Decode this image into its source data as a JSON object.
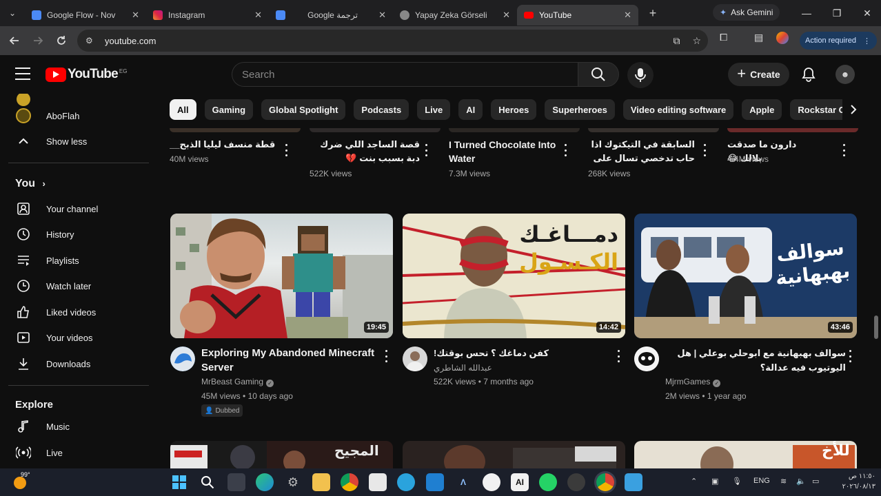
{
  "browser": {
    "tabs": [
      {
        "label": "Google Flow - Nov",
        "color": "#4b8af5",
        "active": false
      },
      {
        "label": "Instagram",
        "color": "#d6249f",
        "active": false
      },
      {
        "label": "Google ترجمة",
        "color": "#4b8af5",
        "active": false
      },
      {
        "label": "Yapay Zeka Görseli",
        "color": "#bbbbbb",
        "active": false
      },
      {
        "label": "YouTube",
        "color": "#ff0000",
        "active": true
      }
    ],
    "gemini_label": "Ask Gemini",
    "url": "youtube.com",
    "action_required": "Action required"
  },
  "header": {
    "logo_text": "YouTube",
    "country_code": "EG",
    "search_placeholder": "Search",
    "create_label": "Create"
  },
  "sidebar": {
    "top_items": [
      {
        "label": "AboFlah",
        "icon": "channel-avatar"
      },
      {
        "label": "Show less",
        "icon": "chevron-up-icon"
      }
    ],
    "you_heading": "You",
    "you_items": [
      {
        "label": "Your channel",
        "icon": "channel-icon"
      },
      {
        "label": "History",
        "icon": "history-icon"
      },
      {
        "label": "Playlists",
        "icon": "playlists-icon"
      },
      {
        "label": "Watch later",
        "icon": "clock-icon"
      },
      {
        "label": "Liked videos",
        "icon": "thumbs-up-icon"
      },
      {
        "label": "Your videos",
        "icon": "your-videos-icon"
      },
      {
        "label": "Downloads",
        "icon": "download-icon"
      }
    ],
    "explore_heading": "Explore",
    "explore_items": [
      {
        "label": "Music",
        "icon": "music-icon"
      },
      {
        "label": "Live",
        "icon": "live-icon"
      }
    ]
  },
  "chips": [
    "All",
    "Gaming",
    "Global Spotlight",
    "Podcasts",
    "Live",
    "AI",
    "Heroes",
    "Superheroes",
    "Video editing software",
    "Apple",
    "Rockstar Games"
  ],
  "top_row": [
    {
      "title": "قطة منسف ليليا الذبح__",
      "views": "40M views"
    },
    {
      "title": "قصة الساجد اللي ضرك دبة بسبب بنت 💔",
      "views": "522K views"
    },
    {
      "title": "I Turned Chocolate Into Water",
      "views": "7.3M views"
    },
    {
      "title": "السابقة في التيكتوك اذا حاب تدخصي تسال على حسابي هناك",
      "views": "268K views"
    },
    {
      "title": "دارون ما صدقت بلالك 😂",
      "views": "4.4M views"
    }
  ],
  "videos": [
    {
      "title": "Exploring My Abandoned Minecraft Server",
      "channel": "MrBeast Gaming",
      "verified": true,
      "views": "45M views",
      "age": "10 days ago",
      "duration": "19:45",
      "badge": "Dubbed"
    },
    {
      "title": "كفن دماغك ؟ تحس بوقتك!",
      "channel": "عبدالله الشاطري",
      "verified": false,
      "views": "522K views",
      "age": "7 months ago",
      "duration": "14:42",
      "thumb_text_1": "دمـــاغـك",
      "thumb_text_2": "الكـسـول"
    },
    {
      "title": "سوالف بهبهانية مع ابوحلي بوعلي | هل اليوتيوب فيه عدالة؟",
      "channel": "MjrmGames",
      "verified": true,
      "views": "2M views",
      "age": "1 year ago",
      "duration": "43:46",
      "thumb_text_1": "سوالف",
      "thumb_text_2": "بهبهانية"
    }
  ],
  "bottom_row": {
    "thumb_text": "المجيح",
    "thumb_text_2": "للأخ"
  },
  "taskbar": {
    "weather": "99°",
    "lang": "ENG",
    "time": "١١:٥٠ ص",
    "date": "٢٠٢٦/٠٨/١٣"
  },
  "colors": {
    "yt_red": "#ff0000",
    "bg": "#0f0f0f",
    "chip_bg": "#272727"
  }
}
